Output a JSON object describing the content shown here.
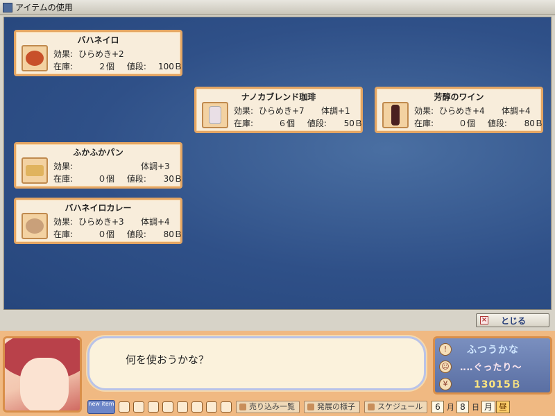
{
  "window": {
    "title": "アイテムの使用"
  },
  "labels": {
    "effect": "効果:",
    "stock": "在庫:",
    "price": "値段:"
  },
  "items": [
    {
      "name": "バハネイロ",
      "effect": "ひらめき+2",
      "effect2": "",
      "stock": "２個",
      "price": "100Ｂ",
      "icon": "soup-bowl-icon",
      "color": "#c8502a"
    },
    {
      "name": "ナノカブレンド珈琲",
      "effect": "ひらめき+7",
      "effect2": "体調+1",
      "stock": "６個",
      "price": "50Ｂ",
      "icon": "coffee-jar-icon",
      "color": "#e9dfe6"
    },
    {
      "name": "芳醇のワイン",
      "effect": "ひらめき+4",
      "effect2": "体調+4",
      "stock": "０個",
      "price": "80Ｂ",
      "icon": "wine-bottle-icon",
      "color": "#4a2020"
    },
    {
      "name": "ふかふかパン",
      "effect": "",
      "effect2": "体調+3",
      "stock": "０個",
      "price": "30Ｂ",
      "icon": "bread-icon",
      "color": "#e0b35e"
    },
    {
      "name": "バハネイロカレー",
      "effect": "ひらめき+3",
      "effect2": "体調+4",
      "stock": "０個",
      "price": "80Ｂ",
      "icon": "curry-plate-icon",
      "color": "#c9a07a"
    }
  ],
  "close_button": {
    "label": "とじる"
  },
  "dialog": {
    "message": "何を使おうかな？"
  },
  "status": {
    "mood": "ふつうかな",
    "condition": "‥‥ぐったり〜",
    "money": "13015Ｂ"
  },
  "toolbar": {
    "logo": "new item",
    "buttons": [
      "売り込み一覧",
      "発展の様子",
      "スケジュール"
    ]
  },
  "date": {
    "month": "6",
    "month_unit": "月",
    "day": "8",
    "day_unit": "日",
    "weekday": "月",
    "time": "昼"
  }
}
